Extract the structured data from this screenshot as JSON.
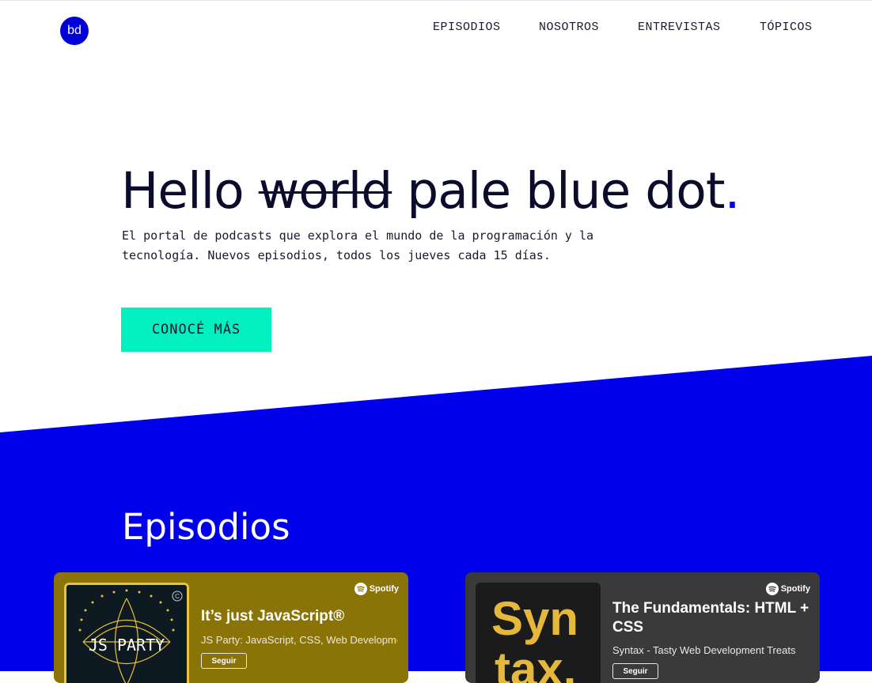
{
  "brand": {
    "logo_text": "bd",
    "accent": "#0000d8",
    "cta_color": "#00f0c0"
  },
  "nav": {
    "items": [
      "EPISODIOS",
      "NOSOTROS",
      "ENTREVISTAS",
      "TÓPICOS"
    ]
  },
  "hero": {
    "title_part1": "Hello ",
    "title_struck": "world",
    "title_part2": " pale blue dot",
    "title_dot": ".",
    "subtitle": "El portal de podcasts que explora el mundo de la programación y la tecnología. Nuevos episodios, todos los jueves cada 15 días.",
    "cta": "CONOCÉ MÁS"
  },
  "episodes": {
    "heading": "Episodios",
    "cards": [
      {
        "title": "It’s just JavaScript®",
        "show": "JS Party: JavaScript, CSS, Web Development",
        "follow": "Seguir",
        "provider": "Spotify",
        "art_text": "JS PARTY",
        "art_badge": "C"
      },
      {
        "title": "The Fundamentals: HTML + CSS",
        "show": "Syntax - Tasty Web Development Treats",
        "follow": "Seguir",
        "provider": "Spotify",
        "art_text_1": "Syn",
        "art_text_2": "tax."
      }
    ]
  }
}
